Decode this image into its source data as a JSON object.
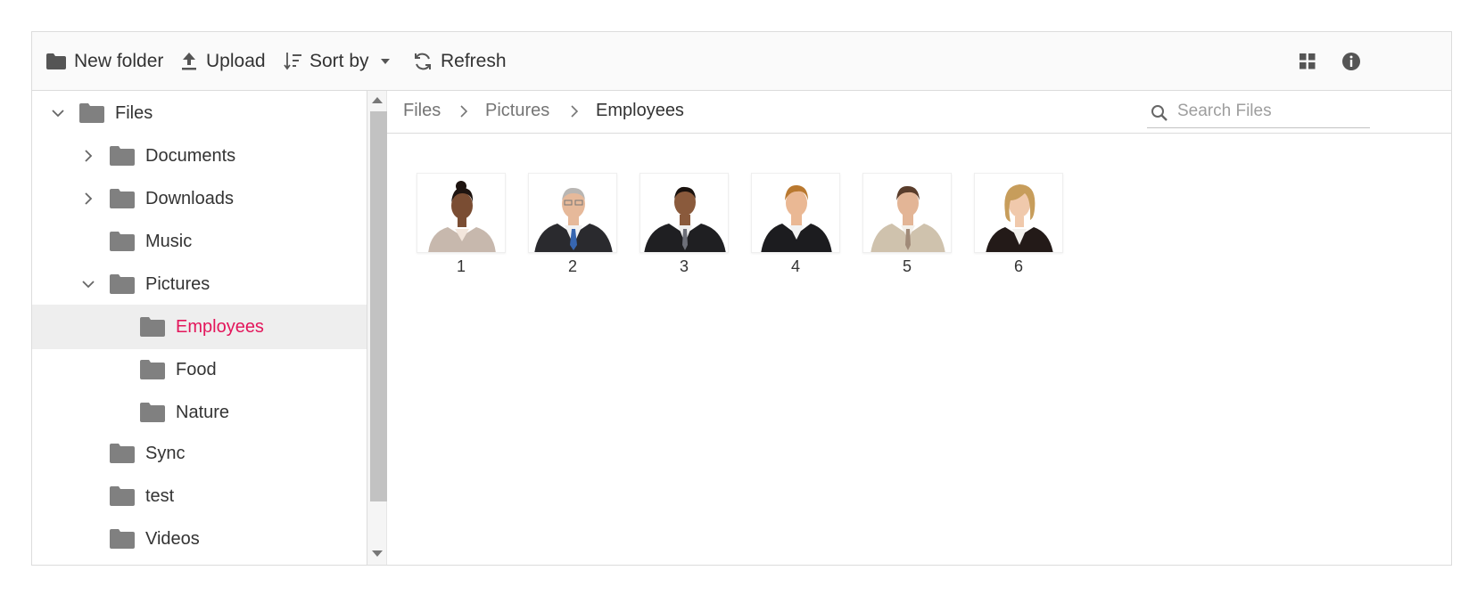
{
  "toolbar": {
    "new_folder_label": "New folder",
    "upload_label": "Upload",
    "sort_by_label": "Sort by",
    "refresh_label": "Refresh"
  },
  "tree": {
    "root": "Files",
    "documents": "Documents",
    "downloads": "Downloads",
    "music": "Music",
    "pictures": "Pictures",
    "employees": "Employees",
    "food": "Food",
    "nature": "Nature",
    "sync": "Sync",
    "test": "test",
    "videos": "Videos"
  },
  "breadcrumb": {
    "items": [
      "Files",
      "Pictures",
      "Employees"
    ]
  },
  "search": {
    "placeholder": "Search Files"
  },
  "files": [
    {
      "name": "1"
    },
    {
      "name": "2"
    },
    {
      "name": "3"
    },
    {
      "name": "4"
    },
    {
      "name": "5"
    },
    {
      "name": "6"
    }
  ],
  "colors": {
    "accent": "#e3165b",
    "selected_bg": "#eeeeee",
    "folder_icon": "#808080"
  },
  "icons": [
    "folder-icon",
    "upload-icon",
    "sort-icon",
    "caret-down-icon",
    "refresh-icon",
    "grid-view-icon",
    "info-icon",
    "search-icon",
    "chevron-right-icon",
    "chevron-down-icon"
  ]
}
